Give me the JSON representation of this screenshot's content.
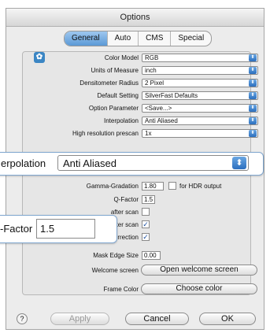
{
  "window": {
    "title": "Options"
  },
  "tabs": [
    "General",
    "Auto",
    "CMS",
    "Special"
  ],
  "settings": [
    {
      "label": "Color Model",
      "value": "RGB"
    },
    {
      "label": "Units of Measure",
      "value": "inch"
    },
    {
      "label": "Densitometer Radius",
      "value": "2 Pixel"
    },
    {
      "label": "Default Setting",
      "value": "SilverFast Defaults"
    },
    {
      "label": "Option Parameter",
      "value": "<Save...>"
    },
    {
      "label": "Interpolation",
      "value": "Anti Aliased"
    },
    {
      "label": "High resolution prescan",
      "value": "1x"
    }
  ],
  "zoom_interpolation": {
    "label": "Interpolation",
    "value": "Anti Aliased",
    "label_visible": "erpolation"
  },
  "gamma": {
    "label": "Gamma-Gradation",
    "value": "1.80",
    "hdr_label": "for HDR output",
    "hdr_checked": false
  },
  "qfactor": {
    "label": "Q-Factor",
    "value": "1.5"
  },
  "zoom_qfactor": {
    "label_visible": "-Factor",
    "value": "1.5"
  },
  "after_scan_1": {
    "label": "after scan",
    "checked": false
  },
  "after_scan_2": {
    "label": "ter scan",
    "checked": true
  },
  "correction": {
    "label": "Correction",
    "checked": true
  },
  "mask_edge": {
    "label": "Mask Edge Size",
    "value": "0.00"
  },
  "welcome": {
    "label": "Welcome screen",
    "button": "Open welcome screen"
  },
  "frame_color": {
    "label": "Frame Color",
    "button": "Choose color"
  },
  "footer": {
    "help": "?",
    "apply": "Apply",
    "cancel": "Cancel",
    "ok": "OK"
  },
  "colors": {
    "accent": "#5b99d6",
    "popup_arrow": "#2c6fbe",
    "highlight_border": "#7fa6cf"
  }
}
